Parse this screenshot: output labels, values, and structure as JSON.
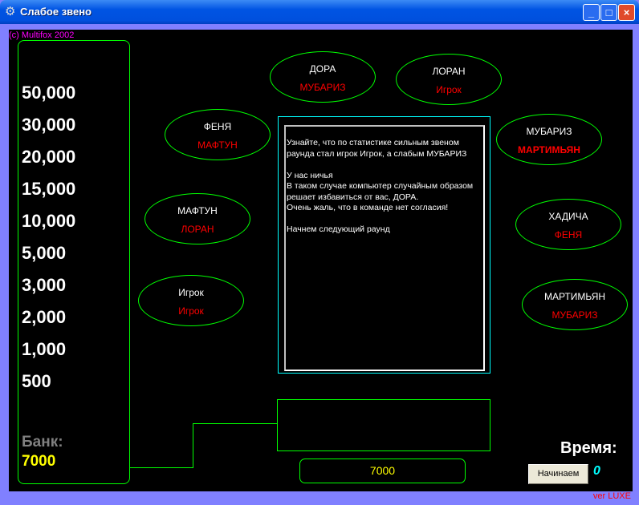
{
  "window": {
    "title": "Слабое звено",
    "icon": "gear-icon",
    "minimize": "_",
    "maximize": "□",
    "close": "×"
  },
  "copyright": "(c) Multifox 2002",
  "version_prefix": "ver ",
  "version": "LUXE",
  "money_chain": [
    "50,000",
    "30,000",
    "20,000",
    "15,000",
    "10,000",
    "5,000",
    "3,000",
    "2,000",
    "1,000",
    "500"
  ],
  "bank": {
    "label": "Банк:",
    "value": "7000"
  },
  "players": [
    {
      "name": "ДОРА",
      "vote": "МУБАРИЗ"
    },
    {
      "name": "ЛОРАН",
      "vote": "Игрок"
    },
    {
      "name": "ФЕНЯ",
      "vote": "МАФТУН"
    },
    {
      "name": "МУБАРИЗ",
      "vote": "МАРТИМЬЯН"
    },
    {
      "name": "МАФТУН",
      "vote": "ЛОРАН"
    },
    {
      "name": "ХАДИЧА",
      "vote": "ФЕНЯ"
    },
    {
      "name": "Игрок",
      "vote": "Игрок"
    },
    {
      "name": "МАРТИМЬЯН",
      "vote": "МУБАРИЗ"
    }
  ],
  "message": "Узнайте, что по статистике сильным звеном раунда стал игрок Игрок, а слабым МУБАРИЗ\n\nУ нас ничья\nВ таком случае компьютер случайным образом решает избавиться от вас, ДОРА.\nОчень жаль, что в команде нет согласия!\n\nНачнем следующий раунд",
  "round_bank": "7000",
  "time_label": "Время:",
  "start_button": "Начинаем",
  "timer": "0"
}
